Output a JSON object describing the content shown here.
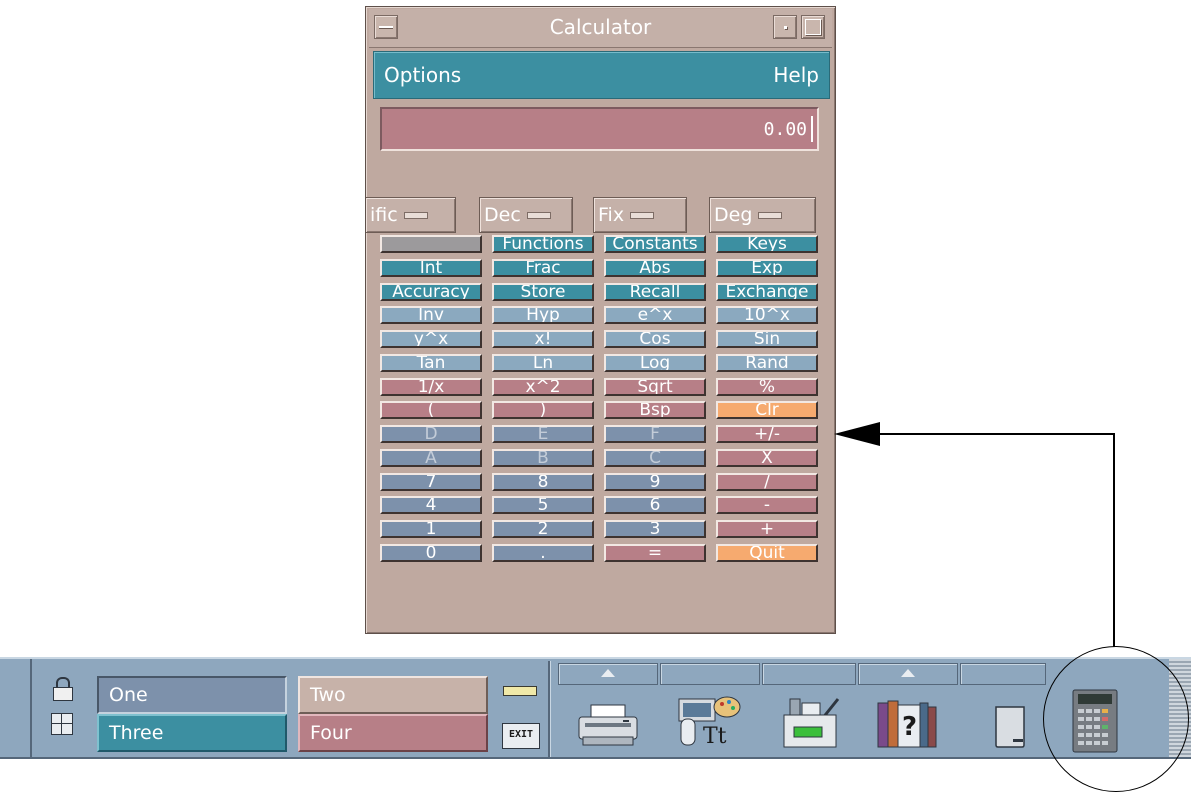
{
  "window": {
    "title": "Calculator",
    "menu": {
      "options": "Options",
      "help": "Help"
    },
    "display_value": "0.00",
    "modes": {
      "mode": "ific",
      "base": "Dec",
      "display_type": "Fix",
      "trig": "Deg"
    },
    "keys": [
      {
        "label": "",
        "color": "gray"
      },
      {
        "label": "Functions",
        "color": "teal"
      },
      {
        "label": "Constants",
        "color": "teal"
      },
      {
        "label": "Keys",
        "color": "teal"
      },
      {
        "label": "Int",
        "color": "teal"
      },
      {
        "label": "Frac",
        "color": "teal"
      },
      {
        "label": "Abs",
        "color": "teal"
      },
      {
        "label": "Exp",
        "color": "teal"
      },
      {
        "label": "Accuracy",
        "color": "teal"
      },
      {
        "label": "Store",
        "color": "teal"
      },
      {
        "label": "Recall",
        "color": "teal"
      },
      {
        "label": "Exchange",
        "color": "teal"
      },
      {
        "label": "Inv",
        "color": "blue"
      },
      {
        "label": "Hyp",
        "color": "blue"
      },
      {
        "label": "e^x",
        "color": "blue"
      },
      {
        "label": "10^x",
        "color": "blue"
      },
      {
        "label": "y^x",
        "color": "blue"
      },
      {
        "label": "x!",
        "color": "blue"
      },
      {
        "label": "Cos",
        "color": "blue"
      },
      {
        "label": "Sin",
        "color": "blue"
      },
      {
        "label": "Tan",
        "color": "blue"
      },
      {
        "label": "Ln",
        "color": "blue"
      },
      {
        "label": "Log",
        "color": "blue"
      },
      {
        "label": "Rand",
        "color": "blue"
      },
      {
        "label": "1/x",
        "color": "rose"
      },
      {
        "label": "x^2",
        "color": "rose"
      },
      {
        "label": "Sqrt",
        "color": "rose"
      },
      {
        "label": "%",
        "color": "rose"
      },
      {
        "label": "(",
        "color": "rose"
      },
      {
        "label": ")",
        "color": "rose"
      },
      {
        "label": "Bsp",
        "color": "rose"
      },
      {
        "label": "Clr",
        "color": "orange"
      },
      {
        "label": "D",
        "color": "slate",
        "dots": true
      },
      {
        "label": "E",
        "color": "slate",
        "dots": true
      },
      {
        "label": "F",
        "color": "slate",
        "dots": true
      },
      {
        "label": "+/-",
        "color": "rose"
      },
      {
        "label": "A",
        "color": "slate",
        "dots": true
      },
      {
        "label": "B",
        "color": "slate",
        "dots": true
      },
      {
        "label": "C",
        "color": "slate",
        "dots": true
      },
      {
        "label": "X",
        "color": "rose"
      },
      {
        "label": "7",
        "color": "slate"
      },
      {
        "label": "8",
        "color": "slate"
      },
      {
        "label": "9",
        "color": "slate"
      },
      {
        "label": "/",
        "color": "rose"
      },
      {
        "label": "4",
        "color": "slate"
      },
      {
        "label": "5",
        "color": "slate"
      },
      {
        "label": "6",
        "color": "slate"
      },
      {
        "label": "-",
        "color": "rose"
      },
      {
        "label": "1",
        "color": "slate"
      },
      {
        "label": "2",
        "color": "slate"
      },
      {
        "label": "3",
        "color": "slate"
      },
      {
        "label": "+",
        "color": "rose"
      },
      {
        "label": "0",
        "color": "slate"
      },
      {
        "label": ".",
        "color": "slate"
      },
      {
        "label": "=",
        "color": "rose"
      },
      {
        "label": "Quit",
        "color": "orange"
      }
    ]
  },
  "panel": {
    "workspaces": {
      "one": "One",
      "two": "Two",
      "three": "Three",
      "four": "Four"
    },
    "exit_label": "EXIT",
    "icons": [
      "lock-icon",
      "workspace-switch-icon",
      "printer-icon",
      "style-manager-icon",
      "file-manager-icon",
      "help-manager-icon",
      "trash-icon",
      "calculator-icon"
    ]
  },
  "colors": {
    "window_bg": "#bfa9a0",
    "teal": "#3c8fa1",
    "rose": "#b77f87",
    "slate": "#7d91ab",
    "light_blue": "#8ba9bf",
    "orange": "#f6aa6f",
    "panel_bg": "#8ea7be"
  }
}
